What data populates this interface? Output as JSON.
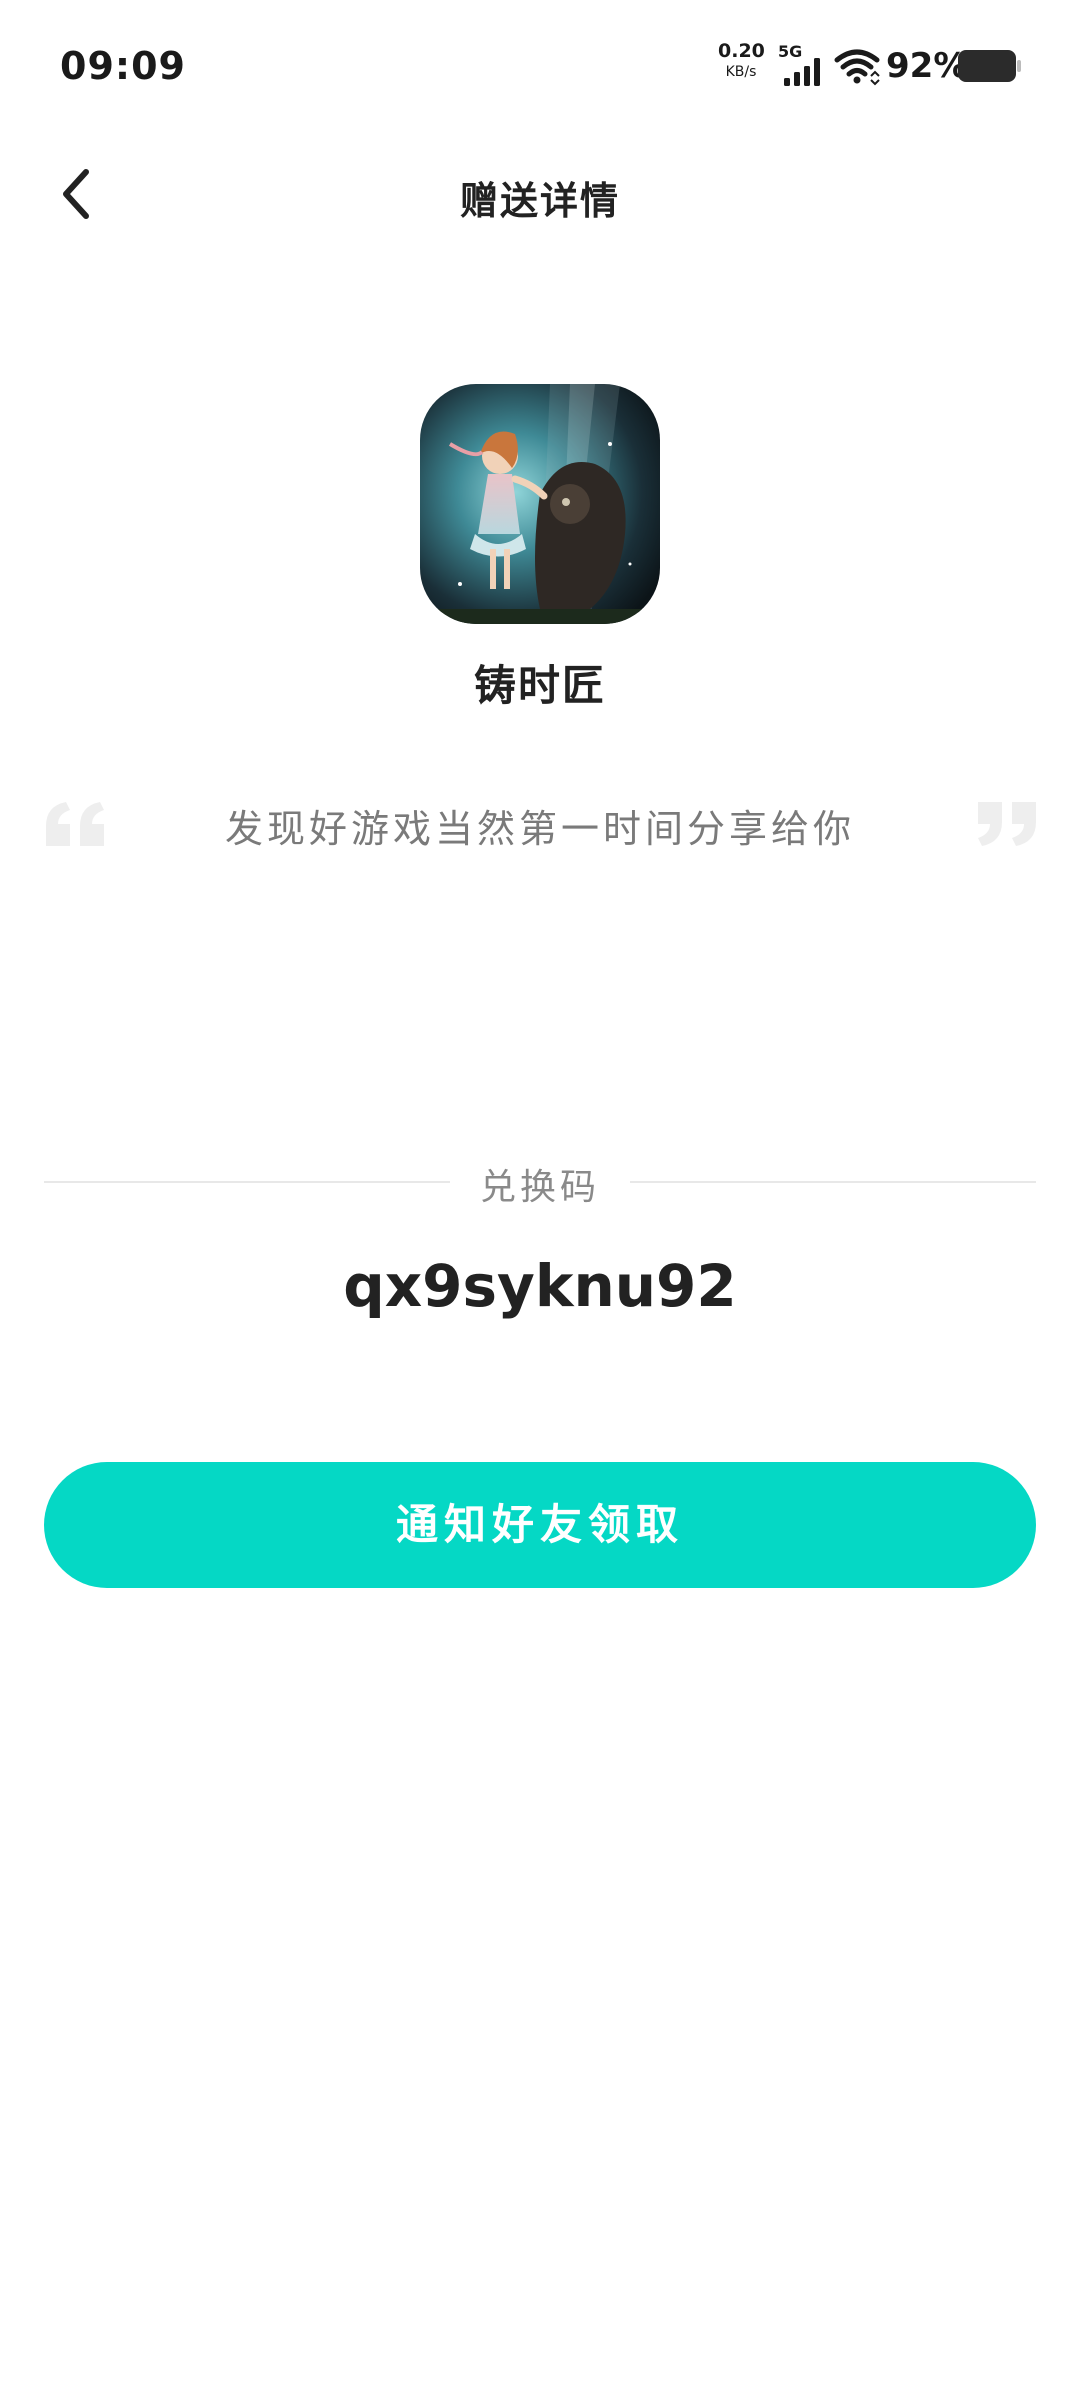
{
  "status_bar": {
    "time": "09:09",
    "net_speed_value": "0.20",
    "net_speed_unit": "KB/s",
    "signal_label": "5G",
    "battery_percent": "92%"
  },
  "header": {
    "title": "赠送详情",
    "back_icon": "chevron-left-icon"
  },
  "game": {
    "name": "铸时匠"
  },
  "quote": {
    "text": "发现好游戏当然第一时间分享给你"
  },
  "redeem": {
    "label": "兑换码",
    "code": "qx9syknu92"
  },
  "actions": {
    "notify_label": "通知好友领取"
  },
  "colors": {
    "accent": "#05d8c5",
    "text_primary": "#222222",
    "text_secondary": "#7a7a7a",
    "divider": "#e8e8e8",
    "quote_mark": "#eeeeee"
  }
}
